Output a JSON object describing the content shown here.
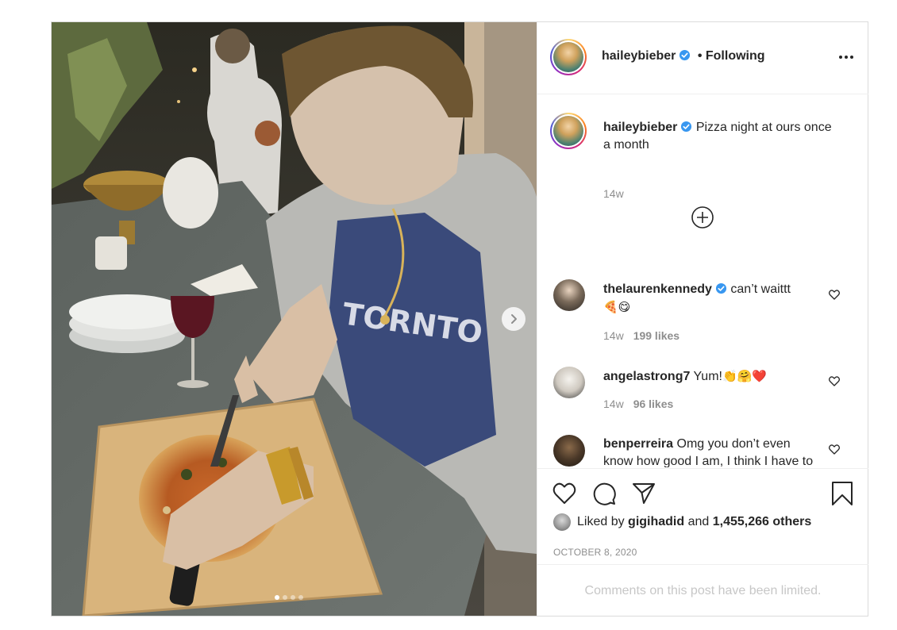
{
  "post": {
    "author": "haileybieber",
    "follow_status": "• Following",
    "caption": "Pizza night at ours once a month",
    "caption_time": "14w",
    "likers_prefix": "Liked by",
    "liker": "gigihadid",
    "likers_joiner": "and",
    "likes_others": "1,455,266 others",
    "date": "OCTOBER 8, 2020",
    "comments_limited_text": "Comments on this post have been limited.",
    "carousel": {
      "slides": 4,
      "current": 1
    }
  },
  "comments": [
    {
      "user": "thelaurenkennedy",
      "verified": true,
      "text": "can’t waittt",
      "emoji": "🍕😋",
      "time": "14w",
      "likes": "199 likes"
    },
    {
      "user": "angelastrong7",
      "verified": false,
      "text": "Yum!",
      "emoji": "👏🤗❤️",
      "time": "14w",
      "likes": "96 likes"
    },
    {
      "user": "benperreira",
      "verified": false,
      "text": "Omg you don’t even know how good I am, I think I have to open a pizza place",
      "emoji": ""
    }
  ],
  "colors": {
    "verified_blue": "#3897f0",
    "secondary_text": "#8e8e8e",
    "border": "#dbdbdb"
  },
  "icons": [
    "more-options-icon",
    "verified-badge-icon",
    "load-more-comments-icon",
    "heart-icon",
    "comment-icon",
    "share-icon",
    "bookmark-icon",
    "chevron-right-icon"
  ]
}
